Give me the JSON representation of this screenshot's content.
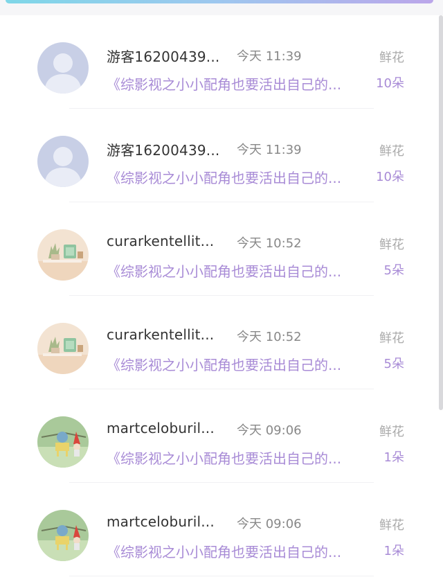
{
  "rows": [
    {
      "name": "游客16200439...",
      "time": "今天 11:39",
      "book": "《综影视之小小配角也要活出自己的...",
      "gift_label": "鲜花",
      "gift_count": "10朵",
      "avatar": "default-user-avatar"
    },
    {
      "name": "游客16200439...",
      "time": "今天 11:39",
      "book": "《综影视之小小配角也要活出自己的...",
      "gift_label": "鲜花",
      "gift_count": "10朵",
      "avatar": "default-user-avatar"
    },
    {
      "name": "curarkentellit...",
      "time": "今天 10:52",
      "book": "《综影视之小小配角也要活出自己的...",
      "gift_label": "鲜花",
      "gift_count": "5朵",
      "avatar": "photo-plants-avatar"
    },
    {
      "name": "curarkentellit...",
      "time": "今天 10:52",
      "book": "《综影视之小小配角也要活出自己的...",
      "gift_label": "鲜花",
      "gift_count": "5朵",
      "avatar": "photo-plants-avatar"
    },
    {
      "name": "martceloburil...",
      "time": "今天 09:06",
      "book": "《综影视之小小配角也要活出自己的...",
      "gift_label": "鲜花",
      "gift_count": "1朵",
      "avatar": "photo-gnome-avatar"
    },
    {
      "name": "martceloburil...",
      "time": "今天 09:06",
      "book": "《综影视之小小配角也要活出自己的...",
      "gift_label": "鲜花",
      "gift_count": "1朵",
      "avatar": "photo-gnome-avatar"
    }
  ],
  "colors": {
    "accent_purple": "#a88bd6",
    "name_text": "#333333",
    "muted_text": "#888888"
  }
}
